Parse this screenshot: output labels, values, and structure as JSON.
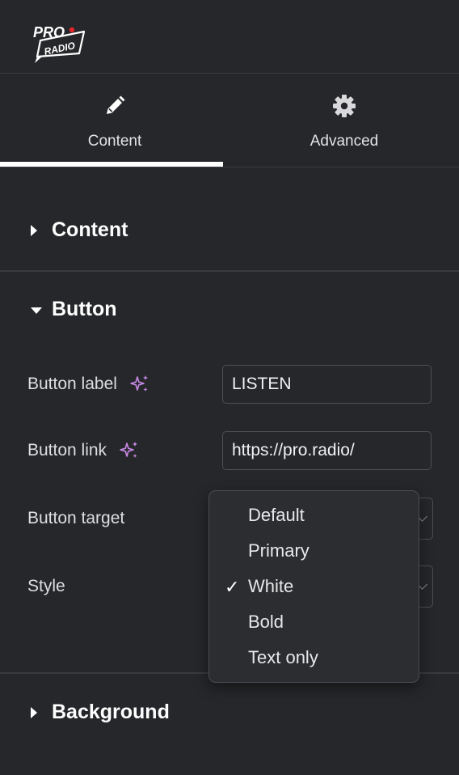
{
  "header": {
    "logo_text_top": "PRO",
    "logo_text_bottom": "RADIO"
  },
  "tabs": [
    {
      "label": "Content",
      "icon": "pencil-icon",
      "active": true
    },
    {
      "label": "Advanced",
      "icon": "gear-icon",
      "active": false
    }
  ],
  "sections": {
    "content": {
      "title": "Content",
      "expanded": false
    },
    "button": {
      "title": "Button",
      "expanded": true
    },
    "background": {
      "title": "Background",
      "expanded": false
    }
  },
  "fields": {
    "button_label": {
      "label": "Button label",
      "value": "LISTEN"
    },
    "button_link": {
      "label": "Button link",
      "value": "https://pro.radio/"
    },
    "button_target": {
      "label": "Button target"
    },
    "style": {
      "label": "Style",
      "selected": "White"
    }
  },
  "dropdown": {
    "options": [
      "Default",
      "Primary",
      "White",
      "Bold",
      "Text only"
    ],
    "checkmark": "✓"
  },
  "colors": {
    "background": "#26272a",
    "accent_sparkle": "#c98ae8",
    "text": "#e8e8ea"
  }
}
